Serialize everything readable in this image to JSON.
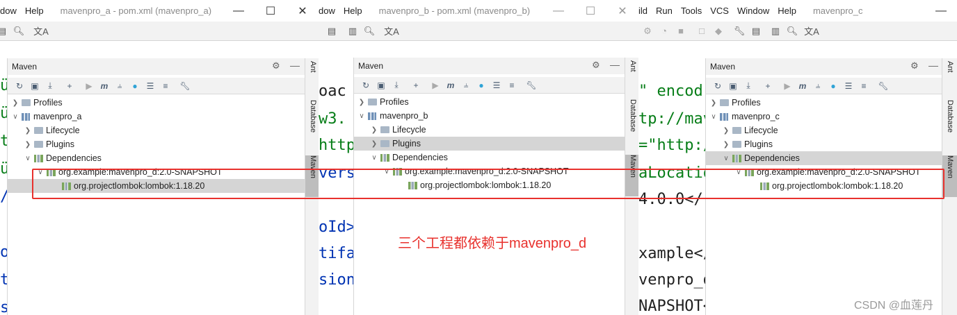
{
  "windows": [
    {
      "menu": [
        "dow",
        "Help"
      ],
      "title": "mavenpro_a - pom.xml (mavenpro_a)",
      "controls": [
        "minimize",
        "maximize",
        "close"
      ],
      "panel_title": "Maven",
      "sidebar_tabs": [
        "Ant",
        "Database",
        "Maven"
      ],
      "code_fragments": [
        "ü",
        "ü",
        "t",
        "ü",
        "/",
        "o",
        "t",
        "s"
      ],
      "tree": [
        {
          "label": "Profiles",
          "level": 0,
          "expanded": false,
          "icon": "folder-icon"
        },
        {
          "label": "mavenpro_a",
          "level": 0,
          "expanded": true,
          "icon": "module-icon"
        },
        {
          "label": "Lifecycle",
          "level": 1,
          "expanded": false,
          "icon": "folder-icon"
        },
        {
          "label": "Plugins",
          "level": 1,
          "expanded": false,
          "icon": "folder-icon"
        },
        {
          "label": "Dependencies",
          "level": 1,
          "expanded": true,
          "icon": "library-icon"
        },
        {
          "label": "org.example:mavenpro_d:2.0-SNAPSHOT",
          "level": 2,
          "expanded": true,
          "icon": "library-icon"
        },
        {
          "label": "org.projectlombok:lombok:1.18.20",
          "level": 3,
          "expanded": false,
          "icon": "library-icon",
          "selected": true
        }
      ]
    },
    {
      "menu": [
        "dow",
        "Help"
      ],
      "title": "mavenpro_b - pom.xml (mavenpro_b)",
      "controls": [
        "minimize",
        "maximize",
        "close"
      ],
      "panel_title": "Maven",
      "sidebar_tabs": [
        "Ant",
        "Database",
        "Maven"
      ],
      "code_fragments": [
        "oac",
        "w3.",
        "http:",
        "vers",
        "oId>",
        "tifa",
        "sion"
      ],
      "tree": [
        {
          "label": "Profiles",
          "level": 0,
          "expanded": false,
          "icon": "folder-icon"
        },
        {
          "label": "mavenpro_b",
          "level": 0,
          "expanded": true,
          "icon": "module-icon"
        },
        {
          "label": "Lifecycle",
          "level": 1,
          "expanded": false,
          "icon": "folder-icon"
        },
        {
          "label": "Plugins",
          "level": 1,
          "expanded": false,
          "icon": "folder-icon",
          "selected": true
        },
        {
          "label": "Dependencies",
          "level": 1,
          "expanded": true,
          "icon": "library-icon"
        },
        {
          "label": "org.example:mavenpro_d:2.0-SNAPSHOT",
          "level": 2,
          "expanded": true,
          "icon": "library-icon"
        },
        {
          "label": "org.projectlombok:lombok:1.18.20",
          "level": 3,
          "expanded": false,
          "icon": "library-icon"
        }
      ]
    },
    {
      "menu": [
        "ild",
        "Run",
        "Tools",
        "VCS",
        "Window",
        "Help"
      ],
      "title": "mavenpro_c",
      "controls": [
        "minimize",
        "maximize",
        "close"
      ],
      "panel_title": "Maven",
      "sidebar_tabs": [
        "Ant",
        "Database",
        "Maven"
      ],
      "code_fragments": [
        "\" encod",
        "tp://mav",
        "=\"http:/",
        "aLocatio",
        "4.0.0</",
        "xample</",
        "venpro_d",
        "NAPSHOT<"
      ],
      "tree": [
        {
          "label": "Profiles",
          "level": 0,
          "expanded": false,
          "icon": "folder-icon"
        },
        {
          "label": "mavenpro_c",
          "level": 0,
          "expanded": true,
          "icon": "module-icon"
        },
        {
          "label": "Lifecycle",
          "level": 1,
          "expanded": false,
          "icon": "folder-icon"
        },
        {
          "label": "Plugins",
          "level": 1,
          "expanded": false,
          "icon": "folder-icon"
        },
        {
          "label": "Dependencies",
          "level": 1,
          "expanded": true,
          "icon": "library-icon",
          "selected": true
        },
        {
          "label": "org.example:mavenpro_d:2.0-SNAPSHOT",
          "level": 2,
          "expanded": true,
          "icon": "library-icon"
        },
        {
          "label": "org.projectlombok:lombok:1.18.20",
          "level": 3,
          "expanded": false,
          "icon": "library-icon"
        }
      ]
    }
  ],
  "annotation": "三个工程都依赖于mavenpro_d",
  "watermark": "CSDN @血莲丹",
  "colors": {
    "annotation": "#e8312d",
    "selection": "#d5d5d5",
    "code_keyword": "#0033b3",
    "code_string": "#067d17",
    "code_text": "#1f1f1f"
  }
}
